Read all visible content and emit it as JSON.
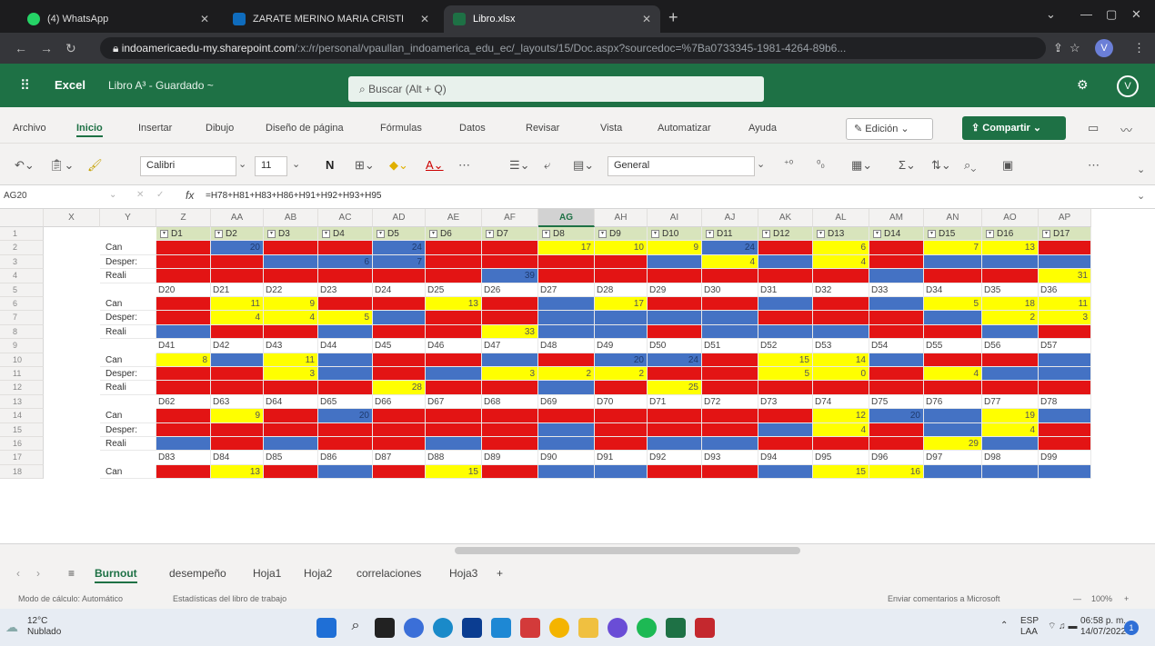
{
  "browser": {
    "tabs": [
      {
        "label": "(4) WhatsApp",
        "color": "#25d366"
      },
      {
        "label": "ZARATE MERINO MARIA CRISTI",
        "color": "#0f6cbd"
      },
      {
        "label": "Libro.xlsx",
        "color": "#1e7145"
      }
    ],
    "url_host": "indoamericaedu-my.sharepoint.com",
    "url_rest": "/:x:/r/personal/vpaullan_indoamerica_edu_ec/_layouts/15/Doc.aspx?sourcedoc=%7Ba0733345-1981-4264-89b6...",
    "profile_initial": "V"
  },
  "excel": {
    "app_name": "Excel",
    "doc_title": "Libro A³ - Guardado ~",
    "search_placeholder": "Buscar (Alt + Q)",
    "user_initial": "V",
    "ribbon_tabs": [
      "Archivo",
      "Inicio",
      "Insertar",
      "Dibujo",
      "Diseño de página",
      "Fórmulas",
      "Datos",
      "Revisar",
      "Vista",
      "Automatizar",
      "Ayuda"
    ],
    "edit_mode": "Edición",
    "share_label": "Compartir",
    "font_name": "Calibri",
    "font_size": "11",
    "number_format": "General",
    "name_box": "AG20",
    "formula": "=H78+H81+H83+H86+H91+H92+H93+H95",
    "selected_column": "AG"
  },
  "sheet": {
    "columns": [
      "X",
      "Y",
      "Z",
      "AA",
      "AB",
      "AC",
      "AD",
      "AE",
      "AF",
      "AG",
      "AH",
      "AI",
      "AJ",
      "AK",
      "AL",
      "AM",
      "AN",
      "AO",
      "AP"
    ],
    "row_numbers": [
      "1",
      "2",
      "3",
      "4",
      "5",
      "6",
      "7",
      "8",
      "9",
      "10",
      "11",
      "12",
      "13",
      "14",
      "15",
      "16",
      "17",
      "18"
    ],
    "row_labels": [
      "Can",
      "Desper:",
      "Reali"
    ],
    "header_row": [
      "D1",
      "D2",
      "D3",
      "D4",
      "D5",
      "D6",
      "D7",
      "D8",
      "D9",
      "D10",
      "D11",
      "D12",
      "D13",
      "D14",
      "D15",
      "D16",
      "D17"
    ],
    "label_rows": [
      [
        "D20",
        "D21",
        "D22",
        "D23",
        "D24",
        "D25",
        "D26",
        "D27",
        "D28",
        "D29",
        "D30",
        "D31",
        "D32",
        "D33",
        "D34",
        "D35",
        "D36"
      ],
      [
        "D41",
        "D42",
        "D43",
        "D44",
        "D45",
        "D46",
        "D47",
        "D48",
        "D49",
        "D50",
        "D51",
        "D52",
        "D53",
        "D54",
        "D55",
        "D56",
        "D57"
      ],
      [
        "D62",
        "D63",
        "D64",
        "D65",
        "D66",
        "D67",
        "D68",
        "D69",
        "D70",
        "D71",
        "D72",
        "D73",
        "D74",
        "D75",
        "D76",
        "D77",
        "D78"
      ],
      [
        "D83",
        "D84",
        "D85",
        "D86",
        "D87",
        "D88",
        "D89",
        "D90",
        "D91",
        "D92",
        "D93",
        "D94",
        "D95",
        "D96",
        "D97",
        "D98",
        "D99"
      ]
    ],
    "blocks": [
      [
        [
          [
            "r",
            ""
          ],
          [
            "b",
            "20"
          ],
          [
            "r",
            ""
          ],
          [
            "r",
            ""
          ],
          [
            "b",
            "24"
          ],
          [
            "r",
            ""
          ],
          [
            "r",
            ""
          ],
          [
            "y",
            "17"
          ],
          [
            "y",
            "10"
          ],
          [
            "y",
            "9"
          ],
          [
            "b",
            "24"
          ],
          [
            "r",
            ""
          ],
          [
            "y",
            "6"
          ],
          [
            "r",
            ""
          ],
          [
            "y",
            "7"
          ],
          [
            "y",
            "13"
          ],
          [
            "r",
            ""
          ]
        ],
        [
          [
            "r",
            ""
          ],
          [
            "r",
            ""
          ],
          [
            "b",
            ""
          ],
          [
            "b",
            "6"
          ],
          [
            "b",
            "7"
          ],
          [
            "r",
            ""
          ],
          [
            "r",
            ""
          ],
          [
            "r",
            ""
          ],
          [
            "r",
            ""
          ],
          [
            "b",
            ""
          ],
          [
            "y",
            "4"
          ],
          [
            "b",
            ""
          ],
          [
            "y",
            "4"
          ],
          [
            "r",
            ""
          ],
          [
            "b",
            ""
          ],
          [
            "b",
            ""
          ],
          [
            "b",
            ""
          ]
        ],
        [
          [
            "r",
            ""
          ],
          [
            "r",
            ""
          ],
          [
            "r",
            ""
          ],
          [
            "r",
            ""
          ],
          [
            "r",
            ""
          ],
          [
            "r",
            ""
          ],
          [
            "b",
            "39"
          ],
          [
            "r",
            ""
          ],
          [
            "r",
            ""
          ],
          [
            "r",
            ""
          ],
          [
            "r",
            ""
          ],
          [
            "r",
            ""
          ],
          [
            "r",
            ""
          ],
          [
            "b",
            ""
          ],
          [
            "r",
            ""
          ],
          [
            "r",
            ""
          ],
          [
            "y",
            "31"
          ]
        ]
      ],
      [
        [
          [
            "r",
            ""
          ],
          [
            "y",
            "11"
          ],
          [
            "y",
            "9"
          ],
          [
            "r",
            ""
          ],
          [
            "r",
            ""
          ],
          [
            "y",
            "13"
          ],
          [
            "r",
            ""
          ],
          [
            "b",
            ""
          ],
          [
            "y",
            "17"
          ],
          [
            "r",
            ""
          ],
          [
            "r",
            ""
          ],
          [
            "b",
            ""
          ],
          [
            "r",
            ""
          ],
          [
            "b",
            ""
          ],
          [
            "y",
            "5"
          ],
          [
            "y",
            "18"
          ],
          [
            "y",
            "11"
          ]
        ],
        [
          [
            "r",
            ""
          ],
          [
            "y",
            "4"
          ],
          [
            "y",
            "4"
          ],
          [
            "y",
            "5"
          ],
          [
            "b",
            ""
          ],
          [
            "r",
            ""
          ],
          [
            "r",
            ""
          ],
          [
            "b",
            ""
          ],
          [
            "b",
            ""
          ],
          [
            "b",
            ""
          ],
          [
            "b",
            ""
          ],
          [
            "r",
            ""
          ],
          [
            "r",
            ""
          ],
          [
            "r",
            ""
          ],
          [
            "b",
            ""
          ],
          [
            "y",
            "2"
          ],
          [
            "y",
            "3"
          ]
        ],
        [
          [
            "b",
            ""
          ],
          [
            "r",
            ""
          ],
          [
            "r",
            ""
          ],
          [
            "b",
            ""
          ],
          [
            "r",
            ""
          ],
          [
            "r",
            ""
          ],
          [
            "y",
            "33"
          ],
          [
            "b",
            ""
          ],
          [
            "b",
            ""
          ],
          [
            "r",
            ""
          ],
          [
            "b",
            ""
          ],
          [
            "b",
            ""
          ],
          [
            "b",
            ""
          ],
          [
            "r",
            ""
          ],
          [
            "r",
            ""
          ],
          [
            "b",
            ""
          ],
          [
            "r",
            ""
          ]
        ]
      ],
      [
        [
          [
            "y",
            "8"
          ],
          [
            "b",
            ""
          ],
          [
            "y",
            "11"
          ],
          [
            "b",
            ""
          ],
          [
            "r",
            ""
          ],
          [
            "r",
            ""
          ],
          [
            "b",
            ""
          ],
          [
            "r",
            ""
          ],
          [
            "b",
            "20"
          ],
          [
            "b",
            "24"
          ],
          [
            "r",
            ""
          ],
          [
            "y",
            "15"
          ],
          [
            "y",
            "14"
          ],
          [
            "b",
            ""
          ],
          [
            "r",
            ""
          ],
          [
            "r",
            ""
          ],
          [
            "b",
            ""
          ]
        ],
        [
          [
            "r",
            ""
          ],
          [
            "r",
            ""
          ],
          [
            "y",
            "3"
          ],
          [
            "b",
            ""
          ],
          [
            "r",
            ""
          ],
          [
            "b",
            ""
          ],
          [
            "y",
            "3"
          ],
          [
            "y",
            "2"
          ],
          [
            "y",
            "2"
          ],
          [
            "r",
            ""
          ],
          [
            "r",
            ""
          ],
          [
            "y",
            "5"
          ],
          [
            "y",
            "0"
          ],
          [
            "r",
            ""
          ],
          [
            "y",
            "4"
          ],
          [
            "b",
            ""
          ],
          [
            "b",
            ""
          ]
        ],
        [
          [
            "r",
            ""
          ],
          [
            "r",
            ""
          ],
          [
            "r",
            ""
          ],
          [
            "r",
            ""
          ],
          [
            "y",
            "28"
          ],
          [
            "r",
            ""
          ],
          [
            "r",
            ""
          ],
          [
            "b",
            ""
          ],
          [
            "r",
            ""
          ],
          [
            "y",
            "25"
          ],
          [
            "r",
            ""
          ],
          [
            "r",
            ""
          ],
          [
            "r",
            ""
          ],
          [
            "r",
            ""
          ],
          [
            "r",
            ""
          ],
          [
            "r",
            ""
          ],
          [
            "r",
            ""
          ]
        ]
      ],
      [
        [
          [
            "r",
            ""
          ],
          [
            "y",
            "9"
          ],
          [
            "r",
            ""
          ],
          [
            "b",
            "20"
          ],
          [
            "r",
            ""
          ],
          [
            "r",
            ""
          ],
          [
            "r",
            ""
          ],
          [
            "r",
            ""
          ],
          [
            "r",
            ""
          ],
          [
            "r",
            ""
          ],
          [
            "r",
            ""
          ],
          [
            "r",
            ""
          ],
          [
            "y",
            "12"
          ],
          [
            "b",
            "20"
          ],
          [
            "b",
            ""
          ],
          [
            "y",
            "19"
          ],
          [
            "b",
            ""
          ]
        ],
        [
          [
            "r",
            ""
          ],
          [
            "r",
            ""
          ],
          [
            "r",
            ""
          ],
          [
            "r",
            ""
          ],
          [
            "r",
            ""
          ],
          [
            "r",
            ""
          ],
          [
            "r",
            ""
          ],
          [
            "b",
            ""
          ],
          [
            "r",
            ""
          ],
          [
            "r",
            ""
          ],
          [
            "r",
            ""
          ],
          [
            "b",
            ""
          ],
          [
            "y",
            "4"
          ],
          [
            "r",
            ""
          ],
          [
            "b",
            ""
          ],
          [
            "y",
            "4"
          ],
          [
            "r",
            ""
          ]
        ],
        [
          [
            "b",
            ""
          ],
          [
            "r",
            ""
          ],
          [
            "b",
            ""
          ],
          [
            "r",
            ""
          ],
          [
            "r",
            ""
          ],
          [
            "b",
            ""
          ],
          [
            "r",
            ""
          ],
          [
            "b",
            ""
          ],
          [
            "r",
            ""
          ],
          [
            "b",
            ""
          ],
          [
            "b",
            ""
          ],
          [
            "r",
            ""
          ],
          [
            "r",
            ""
          ],
          [
            "r",
            ""
          ],
          [
            "y",
            "29"
          ],
          [
            "b",
            ""
          ],
          [
            "r",
            ""
          ]
        ]
      ],
      [
        [
          [
            "r",
            ""
          ],
          [
            "y",
            "13"
          ],
          [
            "r",
            ""
          ],
          [
            "b",
            ""
          ],
          [
            "r",
            ""
          ],
          [
            "y",
            "15"
          ],
          [
            "r",
            ""
          ],
          [
            "b",
            ""
          ],
          [
            "b",
            ""
          ],
          [
            "r",
            ""
          ],
          [
            "r",
            ""
          ],
          [
            "b",
            ""
          ],
          [
            "y",
            "15"
          ],
          [
            "y",
            "16"
          ],
          [
            "b",
            ""
          ],
          [
            "b",
            ""
          ],
          [
            "b",
            ""
          ]
        ]
      ]
    ]
  },
  "sheet_tabs": [
    "Burnout",
    "desempeño",
    "Hoja1",
    "Hoja2",
    "correlaciones",
    "Hoja3"
  ],
  "status": {
    "calc_mode": "Modo de cálculo: Automático",
    "stats": "Estadísticas del libro de trabajo",
    "feedback": "Enviar comentarios a Microsoft",
    "zoom": "100%"
  },
  "taskbar": {
    "temperature": "12°C",
    "weather": "Nublado",
    "lang": "ESP",
    "lang2": "LAA",
    "time": "06:58 p. m.",
    "date": "14/07/2022",
    "notifications": "1"
  },
  "colors": {
    "red": "#e31414",
    "yellow": "#ffff00",
    "blue": "#4472c4",
    "excel_green": "#1e7145"
  }
}
